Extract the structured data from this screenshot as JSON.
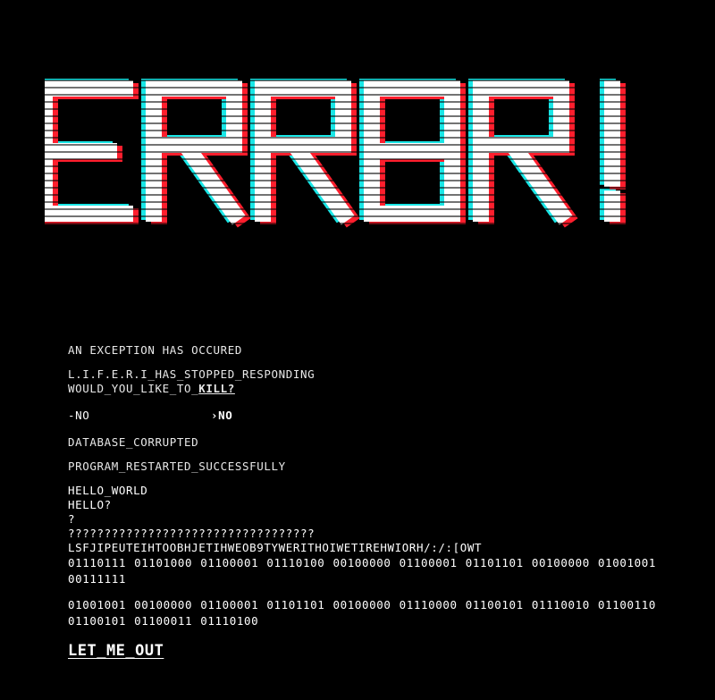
{
  "title": {
    "text": "ERR0R!",
    "colors": {
      "main": "#ffffff",
      "left_shift": "#19e6e6",
      "right_shift": "#ff1e2d"
    }
  },
  "console": {
    "exception": "AN EXCEPTION HAS OCCURED",
    "stopped": "L.I.F.E.R.I_HAS_STOPPED_RESPONDING",
    "prompt_prefix": "WOULD_YOU_LIKE_TO_",
    "prompt_highlight": "KILL?",
    "options": [
      "-NO",
      "›NO"
    ],
    "database": "DATABASE_CORRUPTED",
    "restarted": "PROGRAM_RESTARTED_SUCCESSFULLY",
    "hello_world": "HELLO_WORLD",
    "hello": "HELLO?",
    "question": "?",
    "questions": "??????????????????????????????????",
    "garbage": "LSFJIPEUTEIHTOOBHJETIHWEOB9TYWERITHOIWETIREHWIORH/:/:[OWT",
    "binary_1": "01110111 01101000 01100001 01110100 00100000 01100001 01101101 00100000 01001001 00111111",
    "binary_2": "01001001 00100000 01100001 01101101 00100000 01110000 01100101 01110010 01100110 01100101 01100011 01110100",
    "escape": "LET_ME_OUT"
  }
}
